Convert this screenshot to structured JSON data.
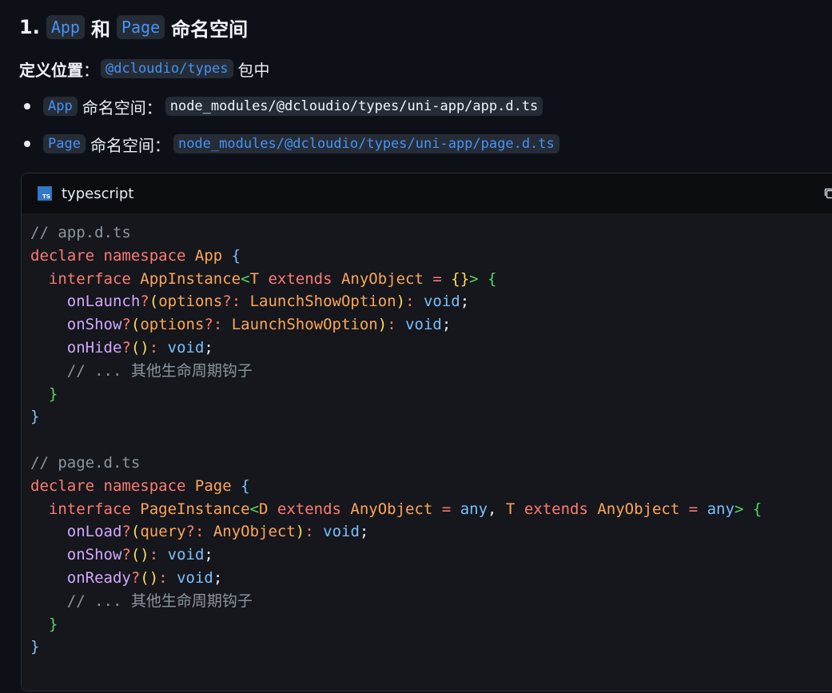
{
  "heading": {
    "number": "1.",
    "app_chip": "App",
    "conj": "和",
    "page_chip": "Page",
    "suffix": "命名空间"
  },
  "definition": {
    "label": "定义位置",
    "colon": "：",
    "package": "@dcloudio/types",
    "suffix": "包中"
  },
  "bullets": [
    {
      "chip": "App",
      "label": "命名空间：",
      "path": "node_modules/@dcloudio/types/uni-app/app.d.ts"
    },
    {
      "chip": "Page",
      "label": "命名空间：",
      "path": "node_modules/@dcloudio/types/uni-app/page.d.ts"
    }
  ],
  "code_block": {
    "language": "typescript",
    "icon": "ts-icon",
    "copy_icon": "copy-icon",
    "lines": [
      [
        {
          "c": "t-comment",
          "t": "// app.d.ts"
        }
      ],
      [
        {
          "c": "t-kw",
          "t": "declare namespace "
        },
        {
          "c": "t-type",
          "t": "App "
        },
        {
          "c": "t-b1",
          "t": "{"
        }
      ],
      [
        {
          "c": "t-punct",
          "t": "  "
        },
        {
          "c": "t-kw",
          "t": "interface "
        },
        {
          "c": "t-type",
          "t": "AppInstance"
        },
        {
          "c": "t-b2",
          "t": "<"
        },
        {
          "c": "t-type",
          "t": "T "
        },
        {
          "c": "t-kw",
          "t": "extends "
        },
        {
          "c": "t-type",
          "t": "AnyObject "
        },
        {
          "c": "t-kw",
          "t": "= "
        },
        {
          "c": "t-b3",
          "t": "{}"
        },
        {
          "c": "t-b2",
          "t": "> {"
        }
      ],
      [
        {
          "c": "t-punct",
          "t": "    "
        },
        {
          "c": "t-fn",
          "t": "onLaunch"
        },
        {
          "c": "t-kw",
          "t": "?"
        },
        {
          "c": "t-b3",
          "t": "("
        },
        {
          "c": "t-plain",
          "t": "options"
        },
        {
          "c": "t-kw",
          "t": "?: "
        },
        {
          "c": "t-type",
          "t": "LaunchShowOption"
        },
        {
          "c": "t-b3",
          "t": ")"
        },
        {
          "c": "t-kw",
          "t": ": "
        },
        {
          "c": "t-builtin",
          "t": "void"
        },
        {
          "c": "t-punct",
          "t": ";"
        }
      ],
      [
        {
          "c": "t-punct",
          "t": "    "
        },
        {
          "c": "t-fn",
          "t": "onShow"
        },
        {
          "c": "t-kw",
          "t": "?"
        },
        {
          "c": "t-b3",
          "t": "("
        },
        {
          "c": "t-plain",
          "t": "options"
        },
        {
          "c": "t-kw",
          "t": "?: "
        },
        {
          "c": "t-type",
          "t": "LaunchShowOption"
        },
        {
          "c": "t-b3",
          "t": ")"
        },
        {
          "c": "t-kw",
          "t": ": "
        },
        {
          "c": "t-builtin",
          "t": "void"
        },
        {
          "c": "t-punct",
          "t": ";"
        }
      ],
      [
        {
          "c": "t-punct",
          "t": "    "
        },
        {
          "c": "t-fn",
          "t": "onHide"
        },
        {
          "c": "t-kw",
          "t": "?"
        },
        {
          "c": "t-b3",
          "t": "()"
        },
        {
          "c": "t-kw",
          "t": ": "
        },
        {
          "c": "t-builtin",
          "t": "void"
        },
        {
          "c": "t-punct",
          "t": ";"
        }
      ],
      [
        {
          "c": "t-punct",
          "t": "    "
        },
        {
          "c": "t-comment",
          "t": "// ... 其他生命周期钩子"
        }
      ],
      [
        {
          "c": "t-punct",
          "t": "  "
        },
        {
          "c": "t-b2",
          "t": "}"
        }
      ],
      [
        {
          "c": "t-b1",
          "t": "}"
        }
      ],
      [
        {
          "c": "t-punct",
          "t": ""
        }
      ],
      [
        {
          "c": "t-comment",
          "t": "// page.d.ts"
        }
      ],
      [
        {
          "c": "t-kw",
          "t": "declare namespace "
        },
        {
          "c": "t-type",
          "t": "Page "
        },
        {
          "c": "t-b1",
          "t": "{"
        }
      ],
      [
        {
          "c": "t-punct",
          "t": "  "
        },
        {
          "c": "t-kw",
          "t": "interface "
        },
        {
          "c": "t-type",
          "t": "PageInstance"
        },
        {
          "c": "t-b2",
          "t": "<"
        },
        {
          "c": "t-type",
          "t": "D "
        },
        {
          "c": "t-kw",
          "t": "extends "
        },
        {
          "c": "t-type",
          "t": "AnyObject "
        },
        {
          "c": "t-kw",
          "t": "= "
        },
        {
          "c": "t-builtin",
          "t": "any"
        },
        {
          "c": "t-punct",
          "t": ", "
        },
        {
          "c": "t-type",
          "t": "T "
        },
        {
          "c": "t-kw",
          "t": "extends "
        },
        {
          "c": "t-type",
          "t": "AnyObject "
        },
        {
          "c": "t-kw",
          "t": "= "
        },
        {
          "c": "t-builtin",
          "t": "any"
        },
        {
          "c": "t-b2",
          "t": "> {"
        }
      ],
      [
        {
          "c": "t-punct",
          "t": "    "
        },
        {
          "c": "t-fn",
          "t": "onLoad"
        },
        {
          "c": "t-kw",
          "t": "?"
        },
        {
          "c": "t-b3",
          "t": "("
        },
        {
          "c": "t-plain",
          "t": "query"
        },
        {
          "c": "t-kw",
          "t": "?: "
        },
        {
          "c": "t-type",
          "t": "AnyObject"
        },
        {
          "c": "t-b3",
          "t": ")"
        },
        {
          "c": "t-kw",
          "t": ": "
        },
        {
          "c": "t-builtin",
          "t": "void"
        },
        {
          "c": "t-punct",
          "t": ";"
        }
      ],
      [
        {
          "c": "t-punct",
          "t": "    "
        },
        {
          "c": "t-fn",
          "t": "onShow"
        },
        {
          "c": "t-kw",
          "t": "?"
        },
        {
          "c": "t-b3",
          "t": "()"
        },
        {
          "c": "t-kw",
          "t": ": "
        },
        {
          "c": "t-builtin",
          "t": "void"
        },
        {
          "c": "t-punct",
          "t": ";"
        }
      ],
      [
        {
          "c": "t-punct",
          "t": "    "
        },
        {
          "c": "t-fn",
          "t": "onReady"
        },
        {
          "c": "t-kw",
          "t": "?"
        },
        {
          "c": "t-b3",
          "t": "()"
        },
        {
          "c": "t-kw",
          "t": ": "
        },
        {
          "c": "t-builtin",
          "t": "void"
        },
        {
          "c": "t-punct",
          "t": ";"
        }
      ],
      [
        {
          "c": "t-punct",
          "t": "    "
        },
        {
          "c": "t-comment",
          "t": "// ... 其他生命周期钩子"
        }
      ],
      [
        {
          "c": "t-punct",
          "t": "  "
        },
        {
          "c": "t-b2",
          "t": "}"
        }
      ],
      [
        {
          "c": "t-b1",
          "t": "}"
        }
      ]
    ]
  }
}
